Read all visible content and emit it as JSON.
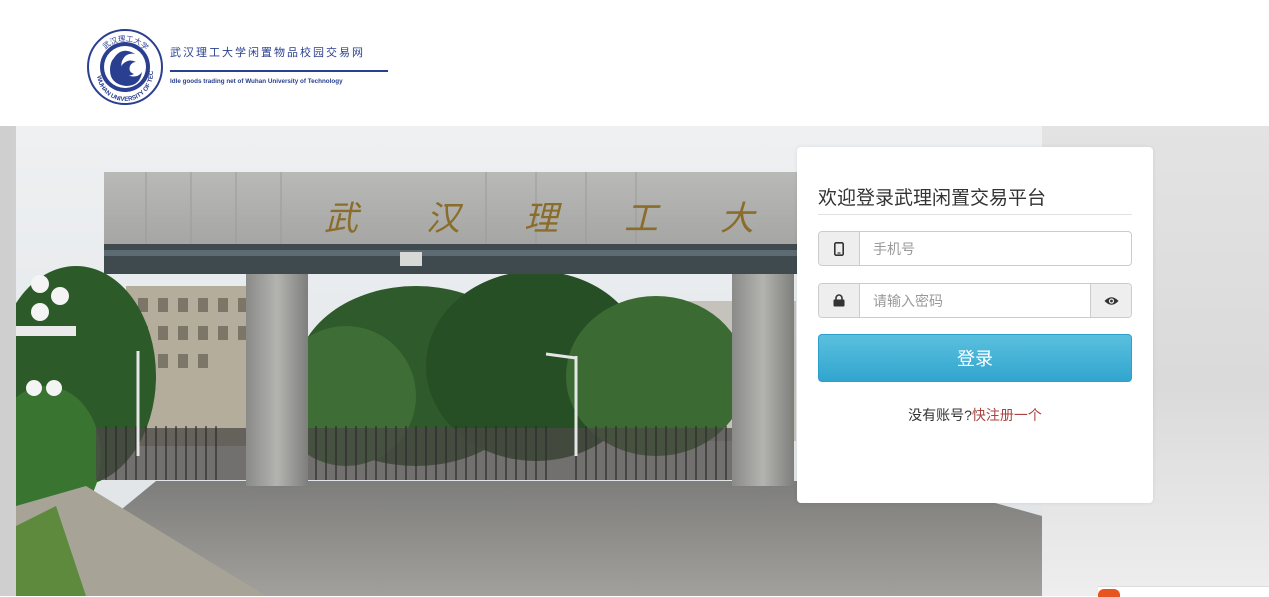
{
  "header": {
    "logo_cn": "武汉理工大学闲置物品校园交易网",
    "logo_en": "Idle goods trading net of Wuhan University of Technology",
    "seal_text": "WUHAN UNIVERSITY OF TECHNOLOGY",
    "seal_top_text": "武汉理工大学"
  },
  "hero": {
    "gate_characters": [
      "武",
      "汉",
      "理",
      "工",
      "大"
    ]
  },
  "login": {
    "title": "欢迎登录武理闲置交易平台",
    "phone_placeholder": "手机号",
    "phone_value": "",
    "password_placeholder": "请输入密码",
    "password_value": "",
    "submit_label": "登录",
    "register_prompt": "没有账号?",
    "register_link": "快注册一个"
  },
  "colors": {
    "brand_blue": "#2a3f8f",
    "button_blue": "#31a5cf",
    "link_red": "#a94442",
    "addon_gray": "#eeeeee"
  },
  "icons": {
    "phone": "mobile-phone-icon",
    "password": "lock-icon",
    "toggle": "eye-icon"
  }
}
